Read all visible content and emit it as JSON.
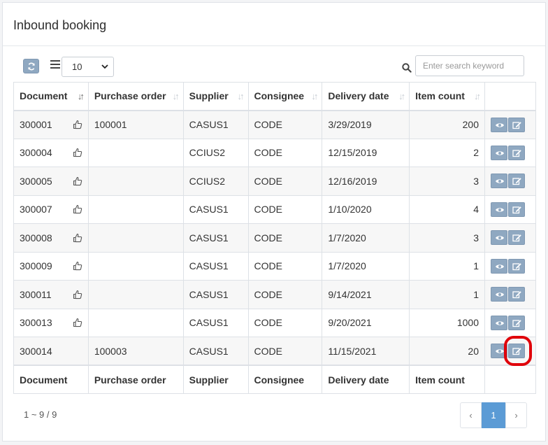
{
  "panel": {
    "title": "Inbound booking"
  },
  "toolbar": {
    "page_size": "10",
    "search_placeholder": "Enter search keyword"
  },
  "table": {
    "columns": [
      "Document",
      "Purchase order",
      "Supplier",
      "Consignee",
      "Delivery date",
      "Item count"
    ],
    "footer_columns": [
      "Document",
      "Purchase order",
      "Supplier",
      "Consignee",
      "Delivery date",
      "Item count"
    ],
    "rows": [
      {
        "document": "300001",
        "purchase_order": "100001",
        "supplier": "CASUS1",
        "consignee": "CODE",
        "delivery_date": "3/29/2019",
        "item_count": "200"
      },
      {
        "document": "300004",
        "purchase_order": "",
        "supplier": "CCIUS2",
        "consignee": "CODE",
        "delivery_date": "12/15/2019",
        "item_count": "2"
      },
      {
        "document": "300005",
        "purchase_order": "",
        "supplier": "CCIUS2",
        "consignee": "CODE",
        "delivery_date": "12/16/2019",
        "item_count": "3"
      },
      {
        "document": "300007",
        "purchase_order": "",
        "supplier": "CASUS1",
        "consignee": "CODE",
        "delivery_date": "1/10/2020",
        "item_count": "4"
      },
      {
        "document": "300008",
        "purchase_order": "",
        "supplier": "CASUS1",
        "consignee": "CODE",
        "delivery_date": "1/7/2020",
        "item_count": "3"
      },
      {
        "document": "300009",
        "purchase_order": "",
        "supplier": "CASUS1",
        "consignee": "CODE",
        "delivery_date": "1/7/2020",
        "item_count": "1"
      },
      {
        "document": "300011",
        "purchase_order": "",
        "supplier": "CASUS1",
        "consignee": "CODE",
        "delivery_date": "9/14/2021",
        "item_count": "1"
      },
      {
        "document": "300013",
        "purchase_order": "",
        "supplier": "CASUS1",
        "consignee": "CODE",
        "delivery_date": "9/20/2021",
        "item_count": "1000"
      },
      {
        "document": "300014",
        "purchase_order": "100003",
        "supplier": "CASUS1",
        "consignee": "CODE",
        "delivery_date": "11/15/2021",
        "item_count": "20"
      }
    ],
    "rows_with_thumb_icon": [
      true,
      true,
      true,
      true,
      true,
      true,
      true,
      true,
      false
    ]
  },
  "pagination": {
    "range_text": "1 ~ 9 / 9",
    "prev": "‹",
    "current": "1",
    "next": "›"
  },
  "colors": {
    "action_button": "#8fa8c1",
    "highlight": "#e0000a",
    "active_page": "#5b9bd5"
  }
}
